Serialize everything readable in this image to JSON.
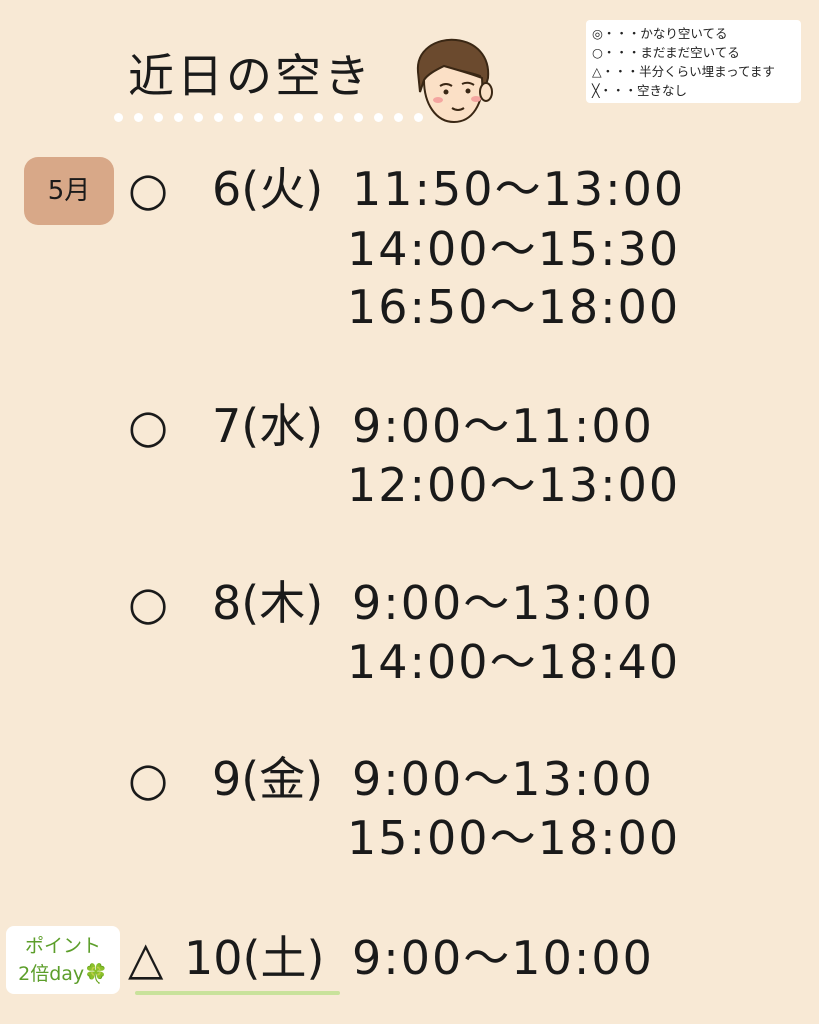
{
  "header": {
    "title": "近日の空き"
  },
  "legend": [
    "◎・・・かなり空いてる",
    "○・・・まだまだ空いてる",
    "△・・・半分くらい埋まってます",
    "╳・・・空きなし"
  ],
  "month": "5月",
  "schedule": [
    {
      "mark": "○",
      "day": "6(火)",
      "slots": [
        "11:50〜13:00",
        "14:00〜15:30",
        "16:50〜18:00"
      ]
    },
    {
      "mark": "○",
      "day": "7(水)",
      "slots": [
        "9:00〜11:00",
        "12:00〜13:00"
      ]
    },
    {
      "mark": "○",
      "day": "8(木)",
      "slots": [
        "9:00〜13:00",
        "14:00〜18:40"
      ]
    },
    {
      "mark": "○",
      "day": "9(金)",
      "slots": [
        "9:00〜13:00",
        "15:00〜18:00"
      ]
    },
    {
      "mark": "△",
      "day": "10(土)",
      "slots": [
        "9:00〜10:00"
      ]
    }
  ],
  "point_badge": {
    "line1": "ポイント",
    "line2": "2倍day",
    "icon": "🍀"
  },
  "colors": {
    "background": "#f8e9d5",
    "month_badge": "#d8a888",
    "point_text": "#5c9e2a",
    "underline": "#c9e29b"
  }
}
